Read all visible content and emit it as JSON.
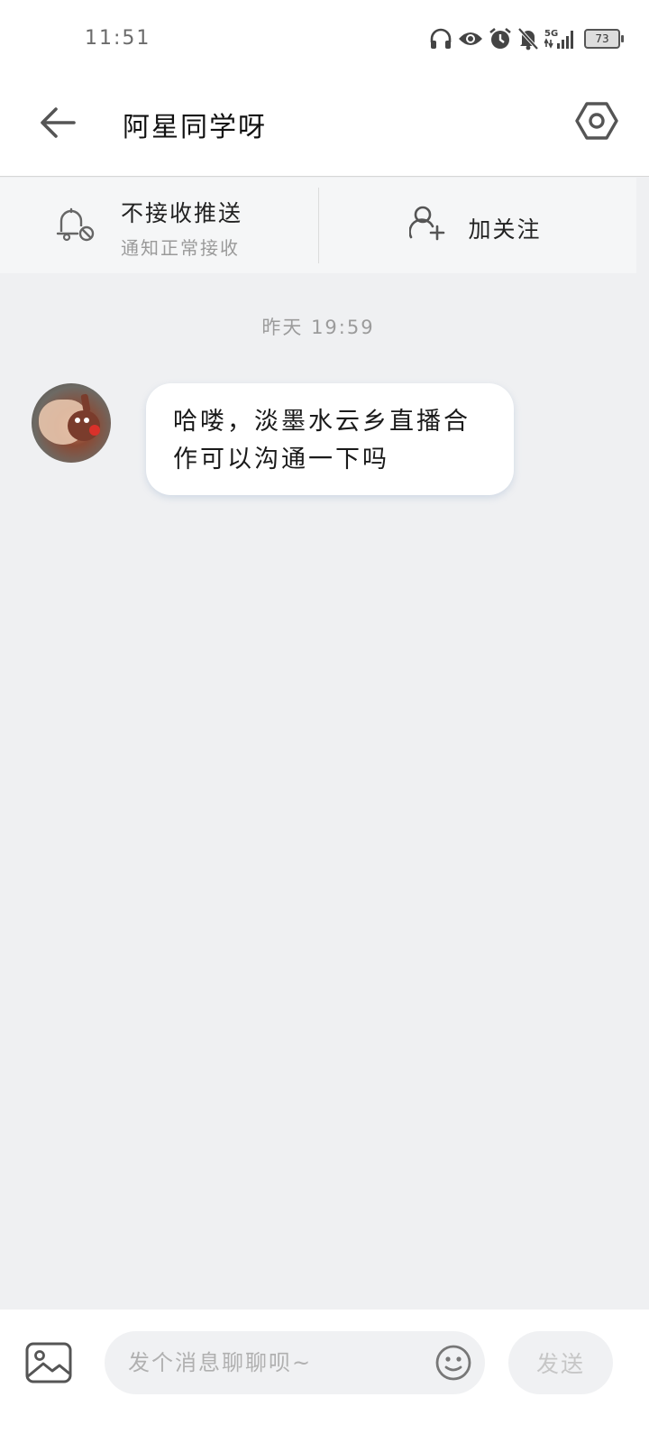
{
  "status_bar": {
    "time": "11:51",
    "battery": "73",
    "network": "5G",
    "icons": [
      "headphones-icon",
      "eye-icon",
      "alarm-icon",
      "bell-off-icon",
      "signal-icon",
      "battery-icon"
    ]
  },
  "header": {
    "title": "阿星同学呀",
    "back_icon": "arrow-left-icon",
    "settings_icon": "hexagon-settings-icon"
  },
  "action_bar": {
    "mute": {
      "title": "不接收推送",
      "subtitle": "通知正常接收",
      "icon": "bell-off-icon"
    },
    "follow": {
      "label": "加关注",
      "icon": "user-add-icon"
    }
  },
  "chat": {
    "timestamp": "昨天 19:59",
    "messages": [
      {
        "sender": "other",
        "text": "哈喽，淡墨水云乡直播合作可以沟通一下吗"
      }
    ]
  },
  "input_bar": {
    "placeholder": "发个消息聊聊呗~",
    "value": "",
    "send_label": "发送",
    "image_icon": "image-icon",
    "emoji_icon": "emoji-icon"
  },
  "colors": {
    "chat_background": "#eff0f2",
    "bubble": "#ffffff",
    "header": "#ffffff",
    "muted_text": "#9b9b9b",
    "send_disabled": "#c6c6c6"
  }
}
